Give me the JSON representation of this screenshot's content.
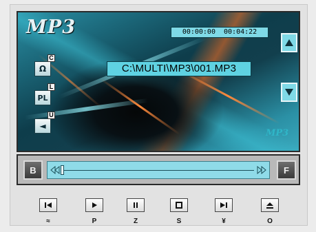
{
  "display": {
    "logo": "MP3",
    "logo_small": "MP3",
    "time": "00:00:00  00:04:22",
    "file_path": "C:\\MULTI\\MP3\\001.MP3"
  },
  "side_buttons": [
    {
      "icon": "repeat-icon",
      "glyph": "Ω",
      "key": "C"
    },
    {
      "icon": "playlist-icon",
      "glyph": "PL",
      "key": "L"
    },
    {
      "icon": "back-icon",
      "glyph": "◄",
      "key": "U"
    }
  ],
  "seek": {
    "back_label": "B",
    "forward_label": "F",
    "position": 0.0
  },
  "transport": [
    {
      "name": "prev",
      "icon": "skip-back-icon",
      "key": "≈"
    },
    {
      "name": "play",
      "icon": "play-icon",
      "key": "P"
    },
    {
      "name": "pause",
      "icon": "pause-icon",
      "key": "Z"
    },
    {
      "name": "stop",
      "icon": "stop-icon",
      "key": "S"
    },
    {
      "name": "next",
      "icon": "skip-forward-icon",
      "key": "¥"
    },
    {
      "name": "eject",
      "icon": "eject-icon",
      "key": "O"
    }
  ]
}
